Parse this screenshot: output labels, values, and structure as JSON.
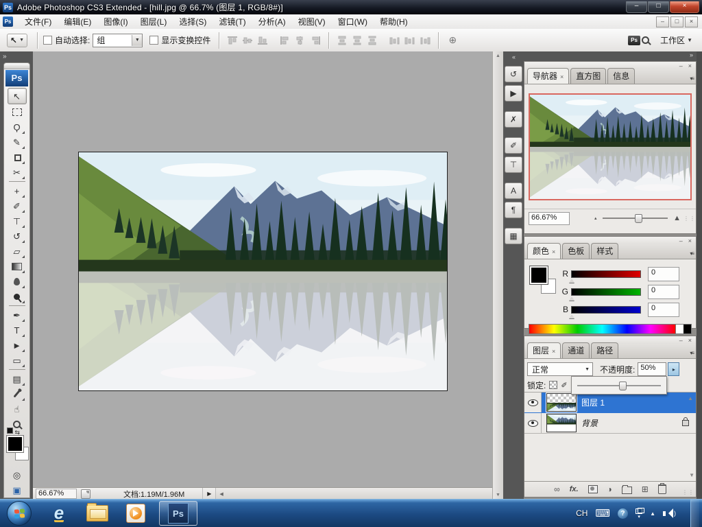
{
  "titlebar": {
    "title": "Adobe Photoshop CS3 Extended - [hill.jpg @ 66.7% (图层 1, RGB/8#)]"
  },
  "menu": {
    "items": [
      "文件(F)",
      "编辑(E)",
      "图像(I)",
      "图层(L)",
      "选择(S)",
      "滤镜(T)",
      "分析(A)",
      "视图(V)",
      "窗口(W)",
      "帮助(H)"
    ]
  },
  "options": {
    "auto_select_label": "自动选择:",
    "auto_select_value": "组",
    "show_transform_label": "显示变换控件",
    "workspace_label": "工作区"
  },
  "navigator": {
    "tabs": [
      "导航器",
      "直方图",
      "信息"
    ],
    "zoom_field": "66.67%"
  },
  "color": {
    "tabs": [
      "颜色",
      "色板",
      "样式"
    ],
    "channels": [
      {
        "label": "R",
        "value": "0"
      },
      {
        "label": "G",
        "value": "0"
      },
      {
        "label": "B",
        "value": "0"
      }
    ]
  },
  "layers": {
    "tabs": [
      "图层",
      "通道",
      "路径"
    ],
    "blend_mode": "正常",
    "opacity_label": "不透明度:",
    "opacity_value": "50%",
    "lock_label": "锁定:",
    "rows": [
      {
        "name": "图层 1"
      },
      {
        "name": "背景"
      }
    ]
  },
  "statusbar": {
    "zoom": "66.67%",
    "doc_info": "文档:1.19M/1.96M"
  },
  "taskbar": {
    "language": "CH",
    "ps_label": "Ps"
  },
  "icons": {
    "app": "Ps",
    "doc_app": "Ps",
    "minimize": "–",
    "restore": "□",
    "close": "×",
    "collapse_right": "»",
    "collapse_left": "«",
    "dropdown": "▼",
    "panel_minimize": "–",
    "panel_close": "×",
    "panel_menu": "▾≡",
    "tab_close": "×",
    "move": "↖",
    "lasso": "Ϙ",
    "quick_select": "✎",
    "slice": "✂",
    "healing": "+",
    "brush": "✐",
    "clone_stamp": "⊤",
    "history_brush": "↺",
    "eraser": "▱",
    "pen": "✒",
    "type": "T",
    "path_select": "►",
    "shape": "▭",
    "notes": "▤",
    "hand": "☝",
    "swap_colors": "⇆",
    "quick_mask": "◎",
    "screen_mode": "▣",
    "auto_align": "⊕",
    "dock_history": "↺",
    "dock_actions": "▶",
    "dock_tool_presets": "✗",
    "dock_brushes": "✐",
    "dock_clone_source": "⊤",
    "dock_character": "A",
    "dock_paragraph": "¶",
    "dock_layer_comps": "▦",
    "zoom_out_mini": "▴",
    "zoom_in_mini": "▲",
    "status_next": "▶",
    "scroll_left": "◀",
    "scroll_up": "▲",
    "scroll_down": "▼",
    "opacity_arrow": "▸",
    "link_layers": "∞",
    "fx": "fx.",
    "adjustment": "◑",
    "new_layer": "⊞",
    "lock_brush": "✐",
    "lock_move": "+",
    "tray_help": "?",
    "tray_up": "▲",
    "tray_caret": "▾",
    "keyboard": "⌨",
    "grip": "⋮⋮"
  }
}
